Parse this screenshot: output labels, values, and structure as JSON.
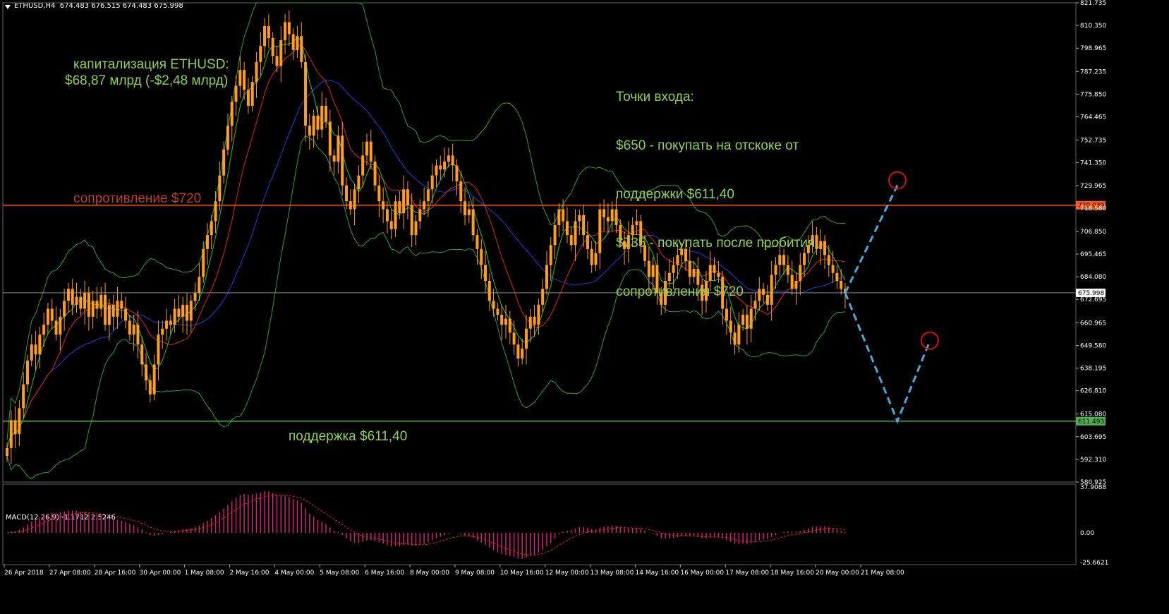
{
  "header": {
    "symbol": "ETHUSD,H4",
    "ohlc": "674.483 676.515 674.483 675.998"
  },
  "macd_label": "MACD(12,26,9) -1.1712 2.5246",
  "annotations": {
    "cap_title": "капитализация ETHUSD:",
    "cap_value": "$68,87 млрд (-$2,48 млрд)",
    "entry_lines": [
      "Точки входа:",
      "$650 - покупать на отскоке от",
      "поддержки $611,40",
      "$735 - покупать после пробития",
      "сопротивления $720"
    ],
    "resistance": "сопротивление $720",
    "support": "поддержка $611,40"
  },
  "colors": {
    "candle": "#ff9d1f",
    "resistance_line": "#ff5a14",
    "support_line": "#4caf50",
    "bollinger": "#2e9e3a",
    "ma_fast": "#22c32e",
    "ma_mid": "#e02020",
    "ma_slow": "#1f3bd9",
    "macd_hist": "#d0207a",
    "macd_signal": "#e02020",
    "forecast": "#4aa8d8",
    "circle": "#d01010"
  },
  "chart_data": {
    "type": "candlestick",
    "timeframe": "H4",
    "ylim": [
      580.925,
      821.735
    ],
    "y_ticks": [
      "821.735",
      "810.350",
      "798.965",
      "787.235",
      "775.850",
      "764.465",
      "752.735",
      "741.350",
      "729.965",
      "718.580",
      "706.850",
      "695.465",
      "684.080",
      "672.695",
      "660.965",
      "649.580",
      "638.195",
      "626.810",
      "615.080",
      "603.695",
      "592.310",
      "580.925"
    ],
    "x_labels": [
      "26 Apr 2018",
      "27 Apr 08:00",
      "28 Apr 16:00",
      "30 Apr 00:00",
      "1 May 08:00",
      "2 May 16:00",
      "4 May 00:00",
      "5 May 08:00",
      "6 May 16:00",
      "8 May 00:00",
      "9 May 08:00",
      "10 May 16:00",
      "12 May 00:00",
      "13 May 08:00",
      "14 May 16:00",
      "16 May 00:00",
      "17 May 08:00",
      "18 May 16:00",
      "20 May 00:00",
      "21 May 08:00"
    ],
    "price_labels": {
      "resistance": "720.039",
      "current": "675.998",
      "support": "611.493"
    },
    "levels": {
      "resistance": 720.039,
      "current": 675.998,
      "support": 611.493
    },
    "closes": [
      598,
      612,
      605,
      618,
      630,
      642,
      650,
      645,
      655,
      660,
      668,
      662,
      655,
      664,
      672,
      678,
      670,
      674,
      668,
      676,
      664,
      672,
      668,
      675,
      660,
      670,
      664,
      672,
      668,
      662,
      655,
      660,
      650,
      640,
      632,
      625,
      640,
      655,
      658,
      662,
      660,
      668,
      664,
      670,
      662,
      672,
      676,
      684,
      698,
      705,
      712,
      722,
      735,
      748,
      760,
      772,
      780,
      788,
      778,
      770,
      782,
      792,
      800,
      810,
      804,
      795,
      790,
      803,
      812,
      806,
      798,
      805,
      792,
      760,
      755,
      765,
      758,
      770,
      762,
      745,
      742,
      755,
      730,
      722,
      718,
      728,
      735,
      745,
      752,
      742,
      730,
      722,
      718,
      712,
      708,
      722,
      716,
      728,
      720,
      705,
      712,
      718,
      722,
      728,
      735,
      740,
      738,
      742,
      745,
      740,
      732,
      722,
      715,
      718,
      705,
      698,
      690,
      682,
      672,
      668,
      665,
      660,
      663,
      656,
      650,
      643,
      648,
      658,
      664,
      660,
      670,
      678,
      690,
      700,
      710,
      718,
      712,
      705,
      700,
      712,
      715,
      705,
      698,
      690,
      696,
      718,
      714,
      712,
      718,
      710,
      702,
      698,
      705,
      710,
      712,
      700,
      692,
      684,
      690,
      676,
      670,
      682,
      686,
      690,
      695,
      698,
      692,
      684,
      688,
      680,
      672,
      682,
      690,
      686,
      684,
      668,
      662,
      656,
      650,
      660,
      665,
      658,
      668,
      672,
      678,
      675,
      670,
      685,
      690,
      695,
      690,
      685,
      678,
      682,
      690,
      696,
      700,
      705,
      698,
      702,
      695,
      690,
      686,
      682,
      678,
      676
    ]
  }
}
